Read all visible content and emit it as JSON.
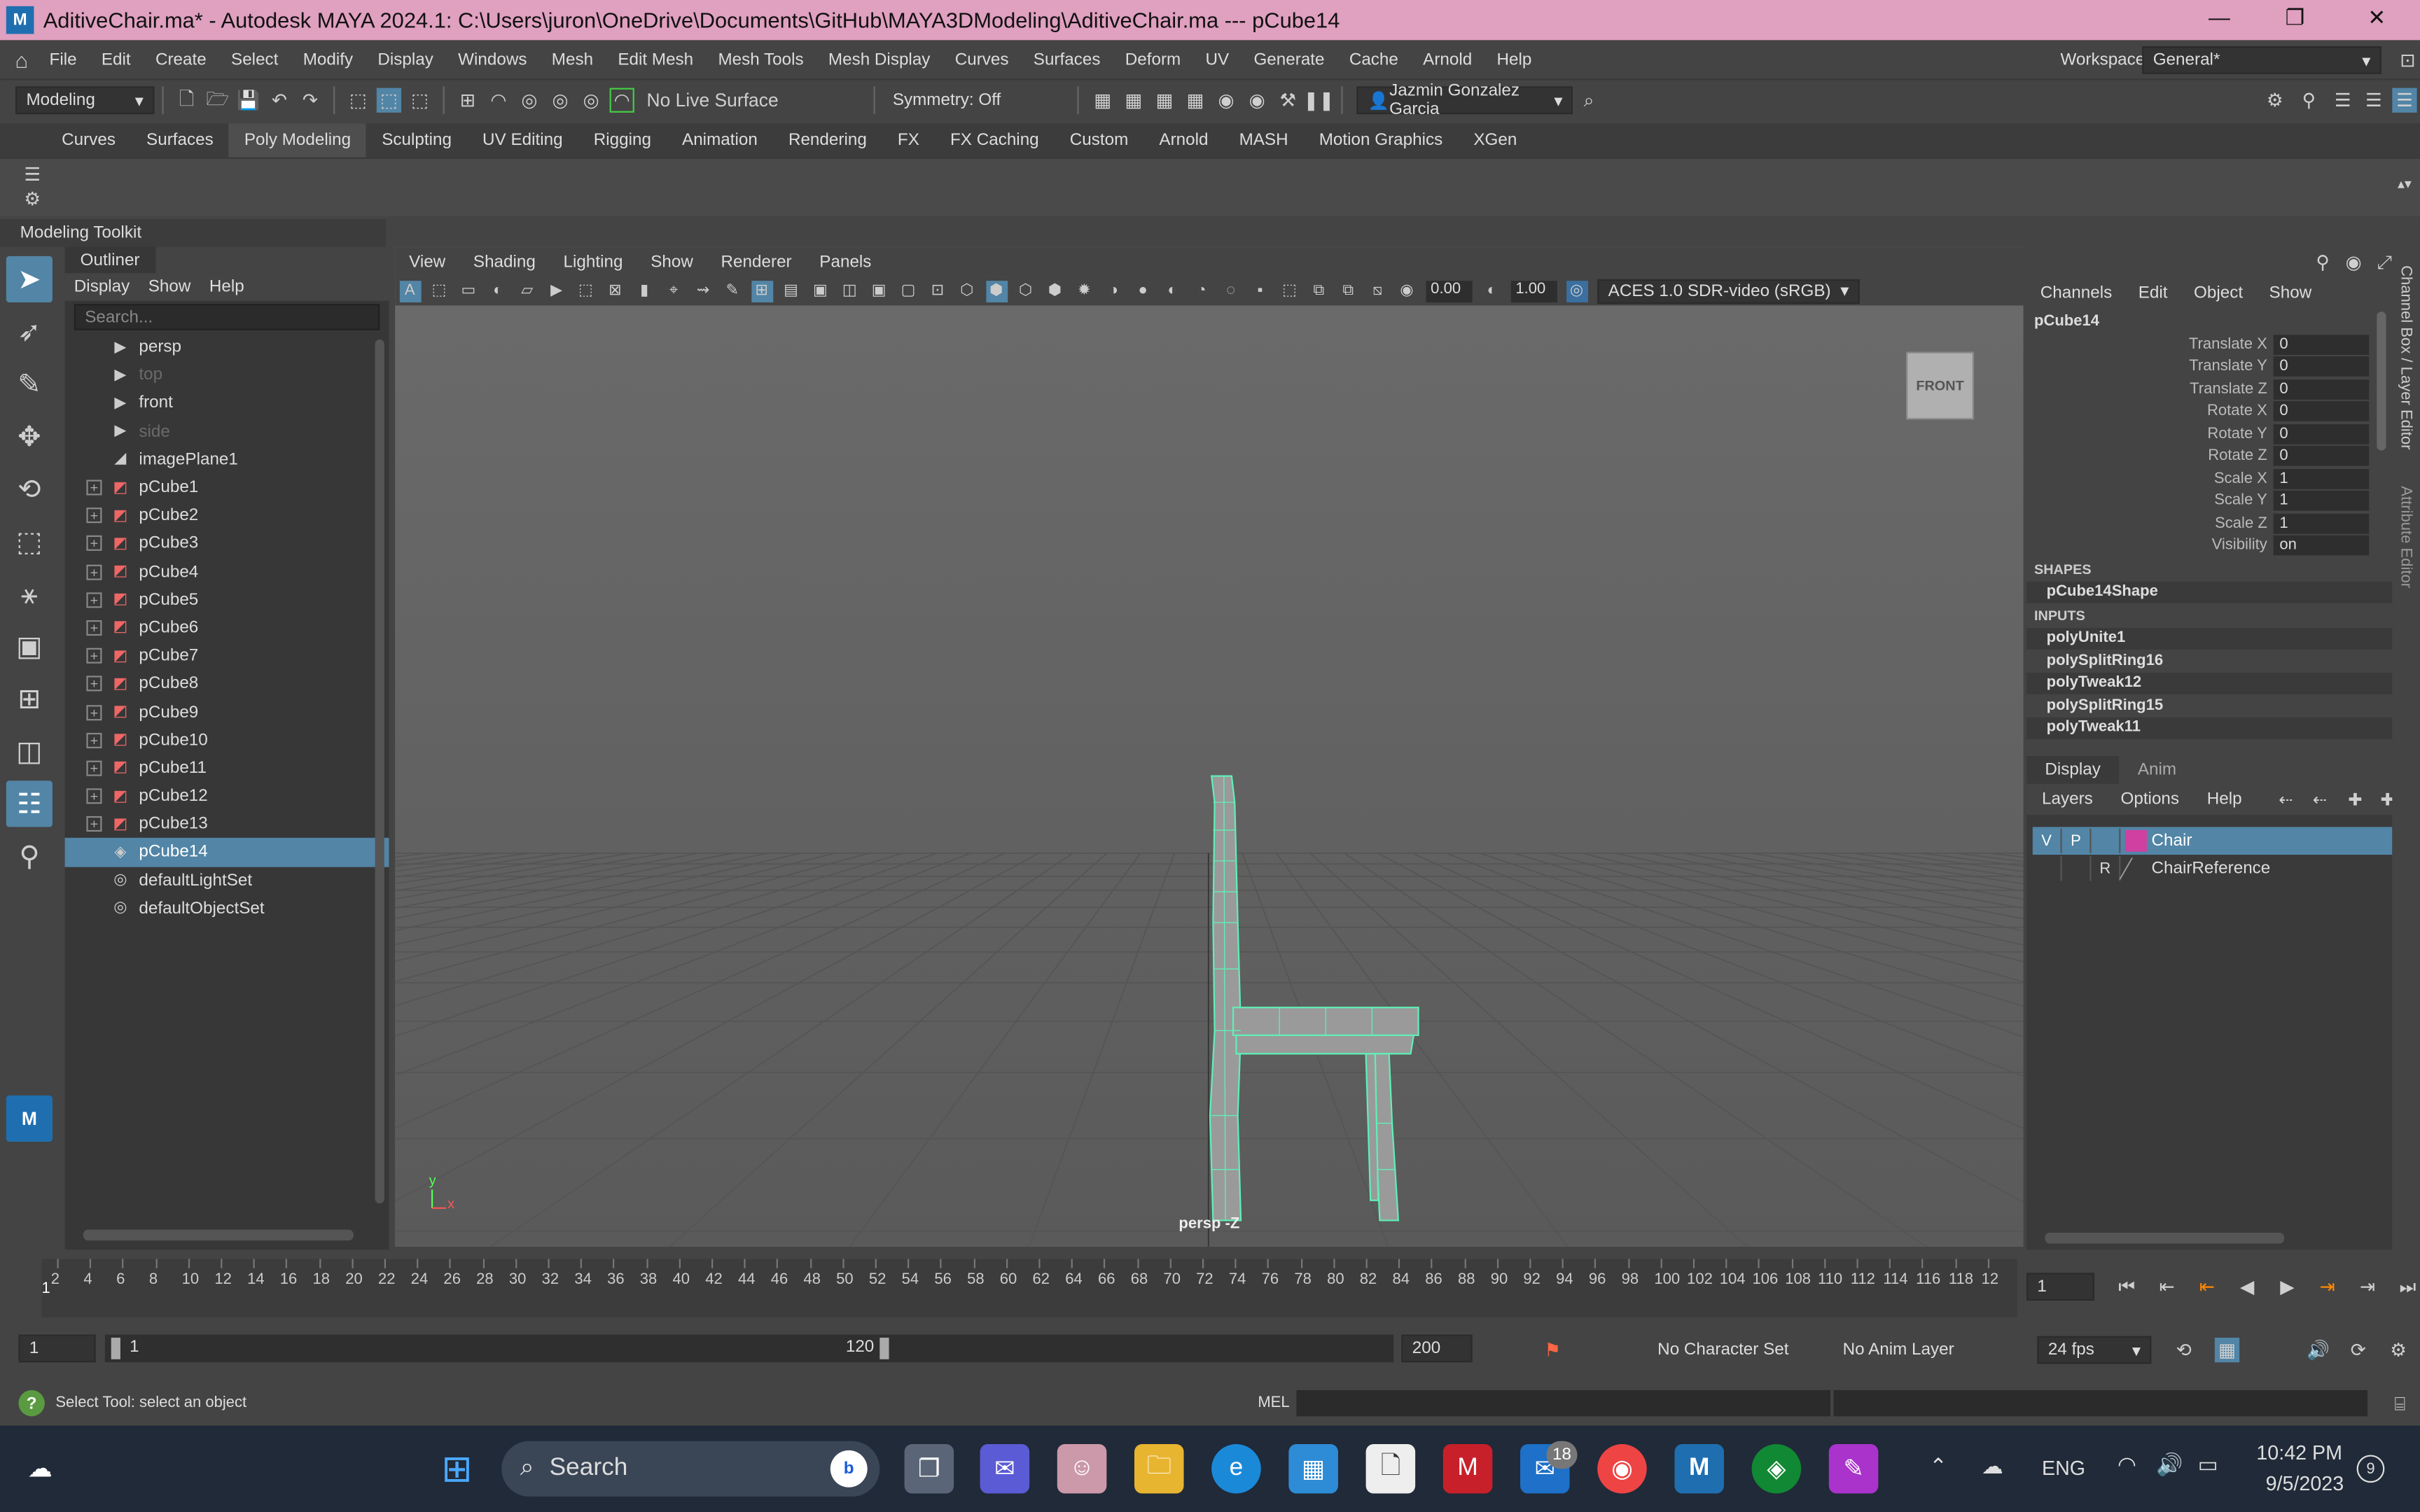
{
  "window": {
    "title": "AditiveChair.ma* - Autodesk MAYA 2024.1: C:\\Users\\juron\\OneDrive\\Documents\\GitHub\\MAYA3DModeling\\AditiveChair.ma   ---   pCube14",
    "logo": "M",
    "min": "—",
    "max": "❐",
    "close": "✕"
  },
  "menu": [
    "File",
    "Edit",
    "Create",
    "Select",
    "Modify",
    "Display",
    "Windows",
    "Mesh",
    "Edit Mesh",
    "Mesh Tools",
    "Mesh Display",
    "Curves",
    "Surfaces",
    "Deform",
    "UV",
    "Generate",
    "Cache",
    "Arnold",
    "Help"
  ],
  "workspace": {
    "label": "Workspace:",
    "value": "General*"
  },
  "statusline": {
    "mode": "Modeling",
    "live_surface": "No Live Surface",
    "symmetry": "Symmetry: Off",
    "user": "Jazmin Gonzalez Garcia"
  },
  "shelf_tabs": [
    "Curves",
    "Surfaces",
    "Poly Modeling",
    "Sculpting",
    "UV Editing",
    "Rigging",
    "Animation",
    "Rendering",
    "FX",
    "FX Caching",
    "Custom",
    "Arnold",
    "MASH",
    "Motion Graphics",
    "XGen"
  ],
  "active_shelf": "Poly Modeling",
  "modeling_toolkit": "Modeling Toolkit",
  "outliner": {
    "tab": "Outliner",
    "menu": [
      "Display",
      "Show",
      "Help"
    ],
    "search_placeholder": "Search...",
    "items": [
      {
        "name": "persp",
        "type": "camera",
        "expand": false,
        "dim": false
      },
      {
        "name": "top",
        "type": "camera",
        "expand": false,
        "dim": true
      },
      {
        "name": "front",
        "type": "camera",
        "expand": false,
        "dim": false
      },
      {
        "name": "side",
        "type": "camera",
        "expand": false,
        "dim": true
      },
      {
        "name": "imagePlane1",
        "type": "image",
        "expand": false,
        "dim": false
      },
      {
        "name": "pCube1",
        "type": "mesh",
        "expand": true,
        "dim": false
      },
      {
        "name": "pCube2",
        "type": "mesh",
        "expand": true,
        "dim": false
      },
      {
        "name": "pCube3",
        "type": "mesh",
        "expand": true,
        "dim": false
      },
      {
        "name": "pCube4",
        "type": "mesh",
        "expand": true,
        "dim": false
      },
      {
        "name": "pCube5",
        "type": "mesh",
        "expand": true,
        "dim": false
      },
      {
        "name": "pCube6",
        "type": "mesh",
        "expand": true,
        "dim": false
      },
      {
        "name": "pCube7",
        "type": "mesh",
        "expand": true,
        "dim": false
      },
      {
        "name": "pCube8",
        "type": "mesh",
        "expand": true,
        "dim": false
      },
      {
        "name": "pCube9",
        "type": "mesh",
        "expand": true,
        "dim": false
      },
      {
        "name": "pCube10",
        "type": "mesh",
        "expand": true,
        "dim": false
      },
      {
        "name": "pCube11",
        "type": "mesh",
        "expand": true,
        "dim": false
      },
      {
        "name": "pCube12",
        "type": "mesh",
        "expand": true,
        "dim": false
      },
      {
        "name": "pCube13",
        "type": "mesh",
        "expand": true,
        "dim": false
      },
      {
        "name": "pCube14",
        "type": "mesh-selected",
        "expand": false,
        "dim": false
      },
      {
        "name": "defaultLightSet",
        "type": "set",
        "expand": false,
        "dim": false
      },
      {
        "name": "defaultObjectSet",
        "type": "set",
        "expand": false,
        "dim": false
      }
    ]
  },
  "viewport": {
    "menu": [
      "View",
      "Shading",
      "Lighting",
      "Show",
      "Renderer",
      "Panels"
    ],
    "exposure": "0.00",
    "gamma": "1.00",
    "colorspace": "ACES 1.0 SDR-video (sRGB)",
    "viewcube": "FRONT",
    "camera_label": "persp -Z",
    "axis_y": "y",
    "axis_x": "x"
  },
  "channelbox": {
    "menu": [
      "Channels",
      "Edit",
      "Object",
      "Show"
    ],
    "object": "pCube14",
    "attrs": [
      {
        "k": "Translate X",
        "v": "0"
      },
      {
        "k": "Translate Y",
        "v": "0"
      },
      {
        "k": "Translate Z",
        "v": "0"
      },
      {
        "k": "Rotate X",
        "v": "0"
      },
      {
        "k": "Rotate Y",
        "v": "0"
      },
      {
        "k": "Rotate Z",
        "v": "0"
      },
      {
        "k": "Scale X",
        "v": "1"
      },
      {
        "k": "Scale Y",
        "v": "1"
      },
      {
        "k": "Scale Z",
        "v": "1"
      },
      {
        "k": "Visibility",
        "v": "on"
      }
    ],
    "shapes_label": "SHAPES",
    "shape": "pCube14Shape",
    "inputs_label": "INPUTS",
    "inputs": [
      "polyUnite1",
      "polySplitRing16",
      "polyTweak12",
      "polySplitRing15",
      "polyTweak11"
    ]
  },
  "layer_editor": {
    "tabs": [
      "Display",
      "Anim"
    ],
    "menu": [
      "Layers",
      "Options",
      "Help"
    ],
    "layers": [
      {
        "v": "V",
        "p": "P",
        "r": "",
        "name": "Chair",
        "color": "#d040a0",
        "selected": true
      },
      {
        "v": "",
        "p": "",
        "r": "R",
        "name": "ChairReference",
        "color": "",
        "selected": false
      }
    ]
  },
  "side_tabs": [
    "Channel Box / Layer Editor",
    "Attribute Editor"
  ],
  "timeline": {
    "ticks": [
      "2",
      "4",
      "6",
      "8",
      "10",
      "12",
      "14",
      "16",
      "18",
      "20",
      "22",
      "24",
      "26",
      "28",
      "30",
      "32",
      "34",
      "36",
      "38",
      "40",
      "42",
      "44",
      "46",
      "48",
      "50",
      "52",
      "54",
      "56",
      "58",
      "60",
      "62",
      "64",
      "66",
      "68",
      "70",
      "72",
      "74",
      "76",
      "78",
      "80",
      "82",
      "84",
      "86",
      "88",
      "90",
      "92",
      "94",
      "96",
      "98",
      "100",
      "102",
      "104",
      "106",
      "108",
      "110",
      "112",
      "114",
      "116",
      "118",
      "12"
    ],
    "current": "1",
    "current_frame_field": "1"
  },
  "range": {
    "start_outer": "1",
    "start_inner": "1",
    "end_inner": "120",
    "end_outer": "200",
    "character_set": "No Character Set",
    "anim_layer": "No Anim Layer",
    "fps": "24 fps"
  },
  "helpline": {
    "text": "Select Tool: select an object",
    "mel": "MEL"
  },
  "taskbar": {
    "search": "Search",
    "lang": "ENG",
    "time": "10:42 PM",
    "date": "9/5/2023",
    "notif": "9",
    "mail_badge": "18"
  }
}
